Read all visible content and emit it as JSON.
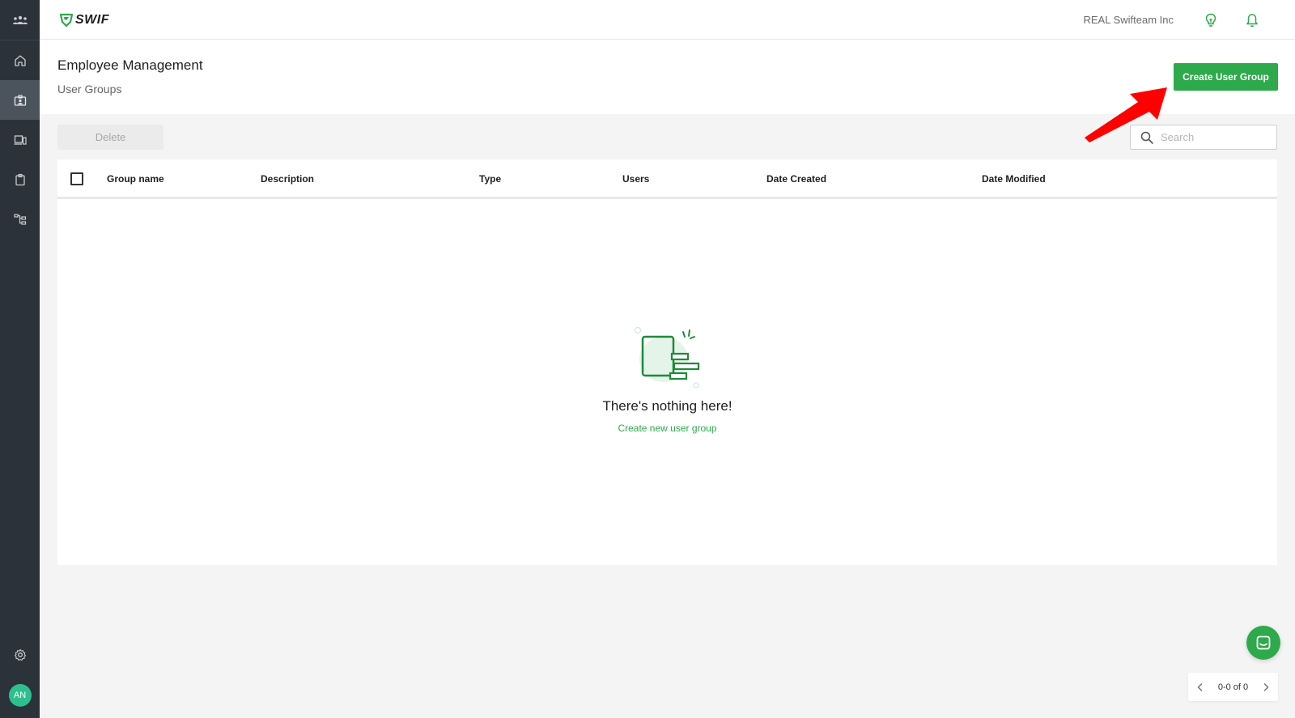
{
  "app": {
    "brand": "SWIF",
    "organization": "REAL Swifteam Inc"
  },
  "colors": {
    "accent": "#2ea94b",
    "sidebar_bg": "#2b323a",
    "avatar_bg": "#2fbf8f"
  },
  "sidebar": {
    "items": [
      {
        "icon": "team-icon"
      },
      {
        "icon": "home-icon"
      },
      {
        "icon": "employee-badge-icon",
        "active": true
      },
      {
        "icon": "devices-icon"
      },
      {
        "icon": "clipboard-icon"
      },
      {
        "icon": "workflow-icon"
      }
    ],
    "settings_icon": "gear-icon",
    "avatar_initials": "AN"
  },
  "header": {
    "title": "Employee Management",
    "subtitle": "User Groups",
    "create_button": "Create User Group"
  },
  "toolbar": {
    "delete_label": "Delete",
    "search_placeholder": "Search"
  },
  "table": {
    "columns": [
      "Group name",
      "Description",
      "Type",
      "Users",
      "Date Created",
      "Date Modified"
    ],
    "rows": []
  },
  "empty_state": {
    "title": "There's nothing here!",
    "link": "Create new user group"
  },
  "pagination": {
    "label": "0-0 of 0"
  }
}
